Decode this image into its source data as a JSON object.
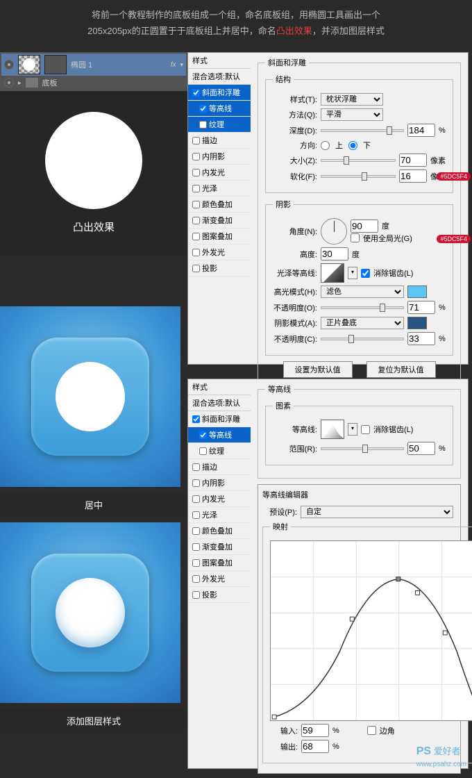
{
  "instructions": {
    "line1": "将前一个教程制作的底板组成一个组，命名底板组，用椭圆工具画出一个",
    "line2a": "205x205px的正圆置于于底板组上并居中，命名",
    "highlight": "凸出效果",
    "line2b": "，并添加图层样式"
  },
  "layers": {
    "row1": {
      "name": "椭圆 1",
      "fx": "fx"
    },
    "row2": {
      "name": "底板"
    }
  },
  "preview": {
    "label1": "凸出效果",
    "label2": "居中",
    "label3": "添加图层样式"
  },
  "styles_panel": {
    "header": "样式",
    "blend": "混合选项:默认",
    "items": [
      "斜面和浮雕",
      "等高线",
      "纹理",
      "描边",
      "内阴影",
      "内发光",
      "光泽",
      "颜色叠加",
      "渐变叠加",
      "图案叠加",
      "外发光",
      "投影"
    ]
  },
  "bevel": {
    "group_title": "斜面和浮雕",
    "structure": "结构",
    "style_label": "样式(T):",
    "style_val": "枕状浮雕",
    "method_label": "方法(Q):",
    "method_val": "平滑",
    "depth_label": "深度(D):",
    "depth_val": "184",
    "pct": "%",
    "dir_label": "方向:",
    "dir_up": "上",
    "dir_down": "下",
    "size_label": "大小(Z):",
    "size_val": "70",
    "px": "像素",
    "soften_label": "软化(F):",
    "soften_val": "16",
    "shadow": "阴影",
    "angle_label": "角度(N):",
    "angle_val": "90",
    "deg": "度",
    "global": "使用全局光(G)",
    "altitude_label": "高度:",
    "altitude_val": "30",
    "gloss_label": "光泽等高线:",
    "antialias": "消除锯齿(L)",
    "highlight_mode": "高光模式(H):",
    "highlight_val": "滤色",
    "opacity1_label": "不透明度(O):",
    "opacity1_val": "71",
    "shadow_mode": "阴影模式(A):",
    "shadow_val": "正片叠底",
    "opacity2_label": "不透明度(C):",
    "opacity2_val": "33",
    "set_default": "设置为默认值",
    "reset_default": "复位为默认值",
    "color1": "#5DC5F4",
    "color2": "#5DC5F4"
  },
  "contour": {
    "group_title": "等高线",
    "elements": "图素",
    "contour_label": "等高线:",
    "antialias": "消除锯齿(L)",
    "range_label": "范围(R):",
    "range_val": "50",
    "pct": "%",
    "editor_title": "等高线编辑器",
    "preset_label": "预设(P):",
    "preset_val": "自定",
    "mapping": "映射",
    "input_label": "输入:",
    "input_val": "59",
    "output_label": "输出:",
    "output_val": "68",
    "corner": "边角"
  },
  "watermark": {
    "ps": "PS",
    "text": "爱好者",
    "url": "www.psahz.com"
  }
}
